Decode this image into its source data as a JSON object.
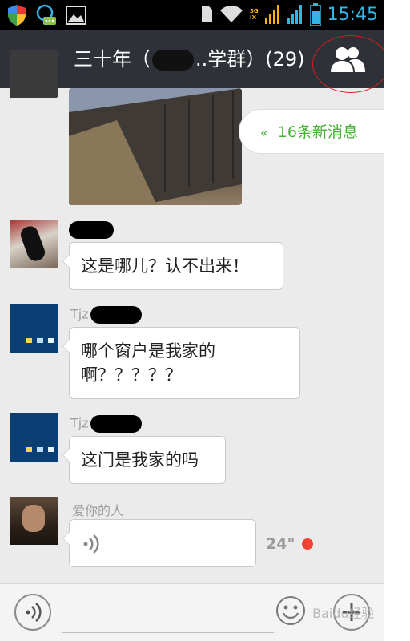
{
  "status_bar": {
    "time": "15:45",
    "network_top": "3G",
    "network_bottom": "IX"
  },
  "header": {
    "title_prefix": "三十年（",
    "title_suffix": "..学群）(29)",
    "back_icon": "arrow-left-icon",
    "group_icon": "group-members-icon"
  },
  "new_messages": {
    "label": "16条新消息",
    "icon": "double-chevron-up-icon"
  },
  "messages": [
    {
      "type": "image",
      "sender": "",
      "text": ""
    },
    {
      "type": "text",
      "sender": "",
      "text": "这是哪儿？认不出来！"
    },
    {
      "type": "text",
      "sender": "Tjz",
      "text_line1": "哪个窗户是我家的",
      "text_line2": "啊？？？？？"
    },
    {
      "type": "text",
      "sender": "Tjz",
      "text": "这门是我家的吗"
    },
    {
      "type": "voice",
      "sender": "爱你的人",
      "duration": "24\""
    }
  ],
  "input_bar": {
    "voice_icon": "voice-input-icon",
    "emoji_icon": "emoji-icon",
    "plus_icon": "plus-icon"
  },
  "watermark": "Baidu经验"
}
